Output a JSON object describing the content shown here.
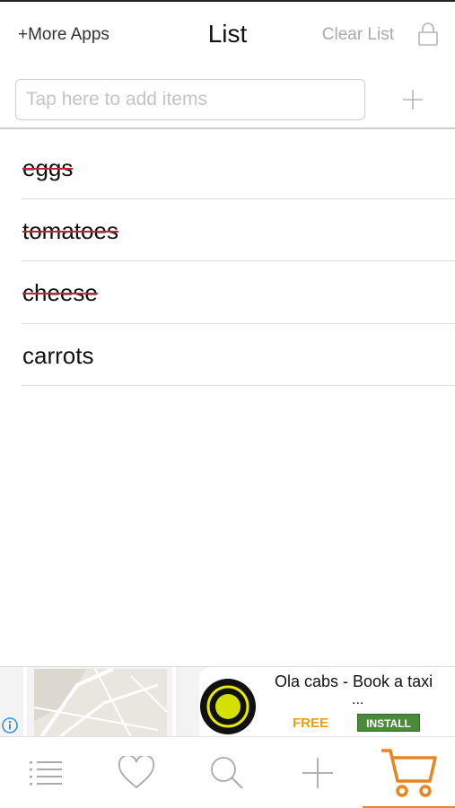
{
  "header": {
    "more_apps_label": "+More Apps",
    "title": "List",
    "clear_list_label": "Clear List",
    "lock_icon": "lock-icon"
  },
  "add_item": {
    "placeholder": "Tap here to add items",
    "value": "",
    "add_icon": "plus-icon"
  },
  "list": {
    "items": [
      {
        "label": "eggs",
        "done": true
      },
      {
        "label": "tomatoes",
        "done": true
      },
      {
        "label": "cheese",
        "done": true
      },
      {
        "label": "carrots",
        "done": false
      }
    ]
  },
  "ad": {
    "title": "Ola cabs - Book a taxi",
    "ellipsis": "...",
    "price_label": "FREE",
    "install_label": "INSTALL",
    "info_icon": "info-icon"
  },
  "tabbar": {
    "tabs": [
      {
        "icon": "list-icon",
        "active": false
      },
      {
        "icon": "heart-icon",
        "active": false
      },
      {
        "icon": "search-icon",
        "active": false
      },
      {
        "icon": "plus-icon",
        "active": false
      },
      {
        "icon": "cart-icon",
        "active": true
      }
    ]
  },
  "colors": {
    "strike": "#c0283a",
    "accent": "#e8851e",
    "muted_text": "#aaaaaa",
    "install_green": "#4a8a3a",
    "free_orange": "#f39c12"
  }
}
